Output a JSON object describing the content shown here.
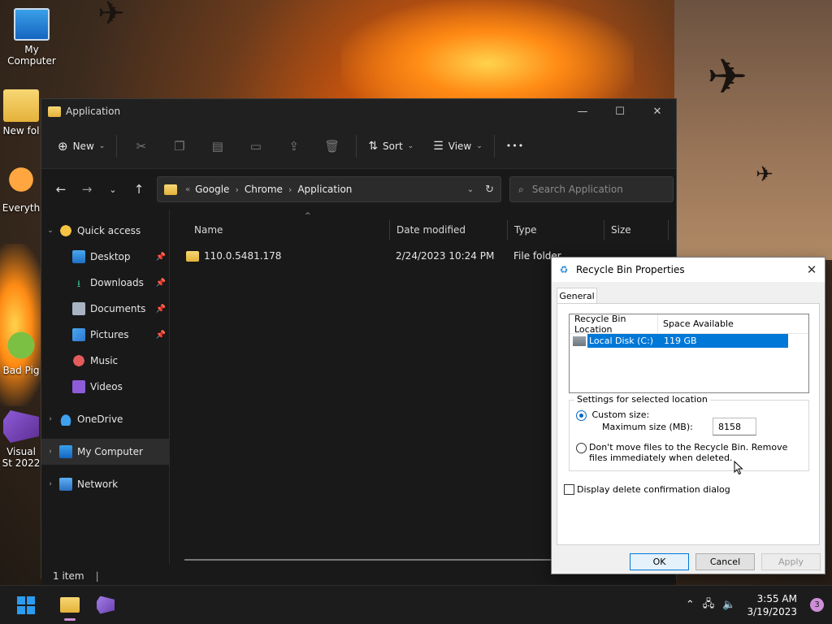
{
  "desktop": {
    "icons": [
      {
        "label": "My Computer"
      },
      {
        "label": "New fol"
      },
      {
        "label": "Everyth"
      },
      {
        "label": "Bad Pig"
      },
      {
        "label": "Visual St 2022"
      }
    ]
  },
  "explorer": {
    "title": "Application",
    "window_controls": {
      "minimize": "—",
      "maximize": "☐",
      "close": "✕"
    },
    "toolbar": {
      "new_label": "New",
      "sort_label": "Sort",
      "view_label": "View",
      "more_label": "•••"
    },
    "address": {
      "crumbs": [
        "Google",
        "Chrome",
        "Application"
      ],
      "overflow": "«"
    },
    "search": {
      "placeholder": "Search Application"
    },
    "nav": {
      "quick_access": "Quick access",
      "items": [
        {
          "label": "Desktop"
        },
        {
          "label": "Downloads"
        },
        {
          "label": "Documents"
        },
        {
          "label": "Pictures"
        },
        {
          "label": "Music"
        },
        {
          "label": "Videos"
        }
      ],
      "onedrive": "OneDrive",
      "my_computer": "My Computer",
      "network": "Network"
    },
    "columns": [
      "Name",
      "Date modified",
      "Type",
      "Size"
    ],
    "rows": [
      {
        "name": "110.0.5481.178",
        "date": "2/24/2023 10:24 PM",
        "type": "File folder",
        "size": ""
      }
    ],
    "status": "1 item"
  },
  "dialog": {
    "title": "Recycle Bin Properties",
    "tab": "General",
    "list_headers": [
      "Recycle Bin Location",
      "Space Available"
    ],
    "list_row": {
      "location": "Local Disk (C:)",
      "space": "119 GB"
    },
    "group_label": "Settings for selected location",
    "custom_size_label": "Custom size:",
    "max_size_label": "Maximum size (MB):",
    "max_size_value": "8158",
    "dont_move_label": "Don't move files to the Recycle Bin. Remove files immediately when deleted.",
    "confirm_label": "Display delete confirmation dialog",
    "ok": "OK",
    "cancel": "Cancel",
    "apply": "Apply"
  },
  "taskbar": {
    "time": "3:55 AM",
    "date": "3/19/2023",
    "notifications": "3"
  }
}
